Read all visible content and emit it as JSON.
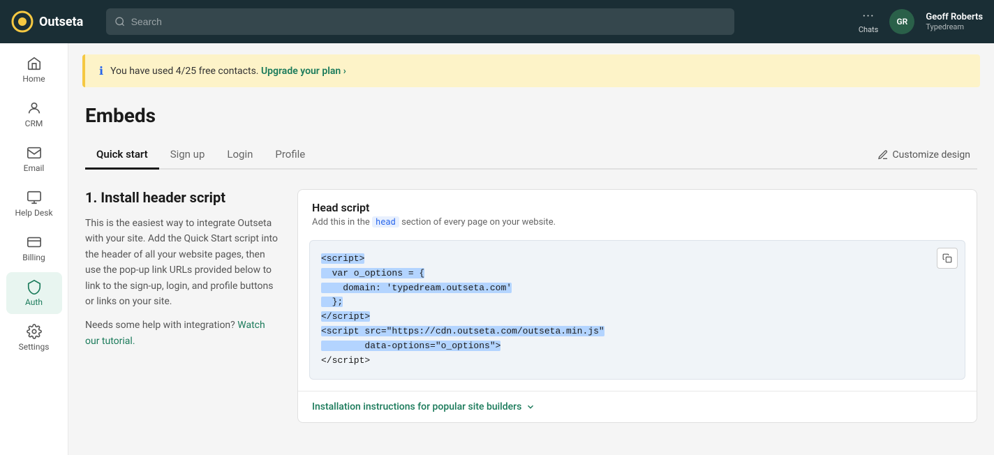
{
  "topnav": {
    "logo_text": "Outseta",
    "search_placeholder": "Search",
    "chats_label": "Chats",
    "user_initials": "GR",
    "user_name": "Geoff Roberts",
    "user_company": "Typedream"
  },
  "sidebar": {
    "items": [
      {
        "id": "home",
        "label": "Home",
        "active": false
      },
      {
        "id": "crm",
        "label": "CRM",
        "active": false
      },
      {
        "id": "email",
        "label": "Email",
        "active": false
      },
      {
        "id": "helpdesk",
        "label": "Help Desk",
        "active": false
      },
      {
        "id": "billing",
        "label": "Billing",
        "active": false
      },
      {
        "id": "auth",
        "label": "Auth",
        "active": true
      },
      {
        "id": "settings",
        "label": "Settings",
        "active": false
      }
    ]
  },
  "banner": {
    "text_before": "You have used 4/25 free contacts.",
    "link_text": "Upgrade your plan ›"
  },
  "page": {
    "title": "Embeds",
    "tabs": [
      {
        "id": "quickstart",
        "label": "Quick start",
        "active": true
      },
      {
        "id": "signup",
        "label": "Sign up",
        "active": false
      },
      {
        "id": "login",
        "label": "Login",
        "active": false
      },
      {
        "id": "profile",
        "label": "Profile",
        "active": false
      }
    ],
    "customize_label": "Customize design"
  },
  "main": {
    "section_title": "1. Install header script",
    "section_desc": "This is the easiest way to integrate Outseta with your site. Add the Quick Start script into the header of all your website pages, then use the pop-up link URLs provided below to link to the sign-up, login, and profile buttons or links on your site.",
    "tutorial_label": "Watch our tutorial.",
    "tutorial_prefix": "Needs some help with integration?",
    "code_card": {
      "title": "Head script",
      "subtitle_prefix": "Add this in the",
      "subtitle_code": "head",
      "subtitle_suffix": "section of every page on your website.",
      "code_line1": "<script>",
      "code_line2": "  var o_options = {",
      "code_line3": "    domain: 'typedream.outseta.com'",
      "code_line4": "  };",
      "code_line5": "</script>",
      "code_line6": "<script src=\"https://cdn.outseta.com/outseta.min.js\"",
      "code_line7": "        data-options=\"o_options\">",
      "code_line8": "</script>",
      "install_label": "Installation instructions for popular site builders"
    }
  }
}
